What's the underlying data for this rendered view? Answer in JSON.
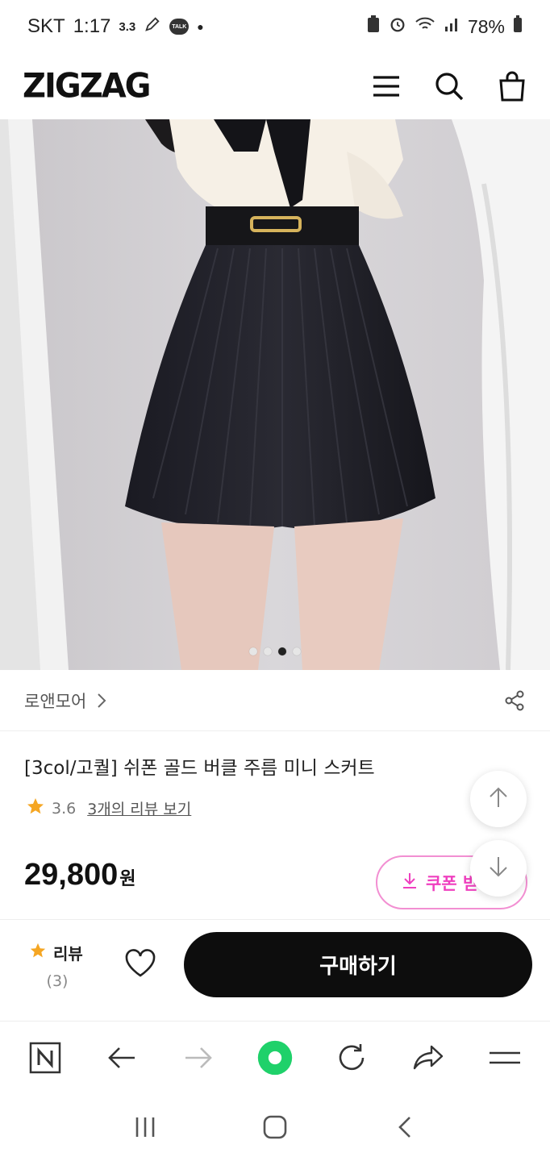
{
  "status_bar": {
    "carrier": "SKT",
    "time": "1:17",
    "extra": "3.3",
    "talk_badge": "TALK",
    "battery": "78%"
  },
  "header": {
    "logo": "ZIGZAG"
  },
  "hero": {
    "slide_count": 4,
    "active_slide": 3
  },
  "store": {
    "name": "로앤모어"
  },
  "product": {
    "title": "[3col/고퀄] 쉬폰 골드 버클 주름 미니 스커트",
    "rating": "3.6",
    "review_link": "3개의 리뷰 보기",
    "price": "29,800",
    "currency": "원"
  },
  "coupon": {
    "label": "쿠폰 받"
  },
  "buy_bar": {
    "review_label": "리뷰",
    "review_count": "(3)",
    "buy_label": "구매하기"
  },
  "colors": {
    "accent_pink": "#ef3fbf",
    "star": "#f5a623",
    "buy_button": "#0d0d0d",
    "browser_green": "#1fd16a"
  }
}
